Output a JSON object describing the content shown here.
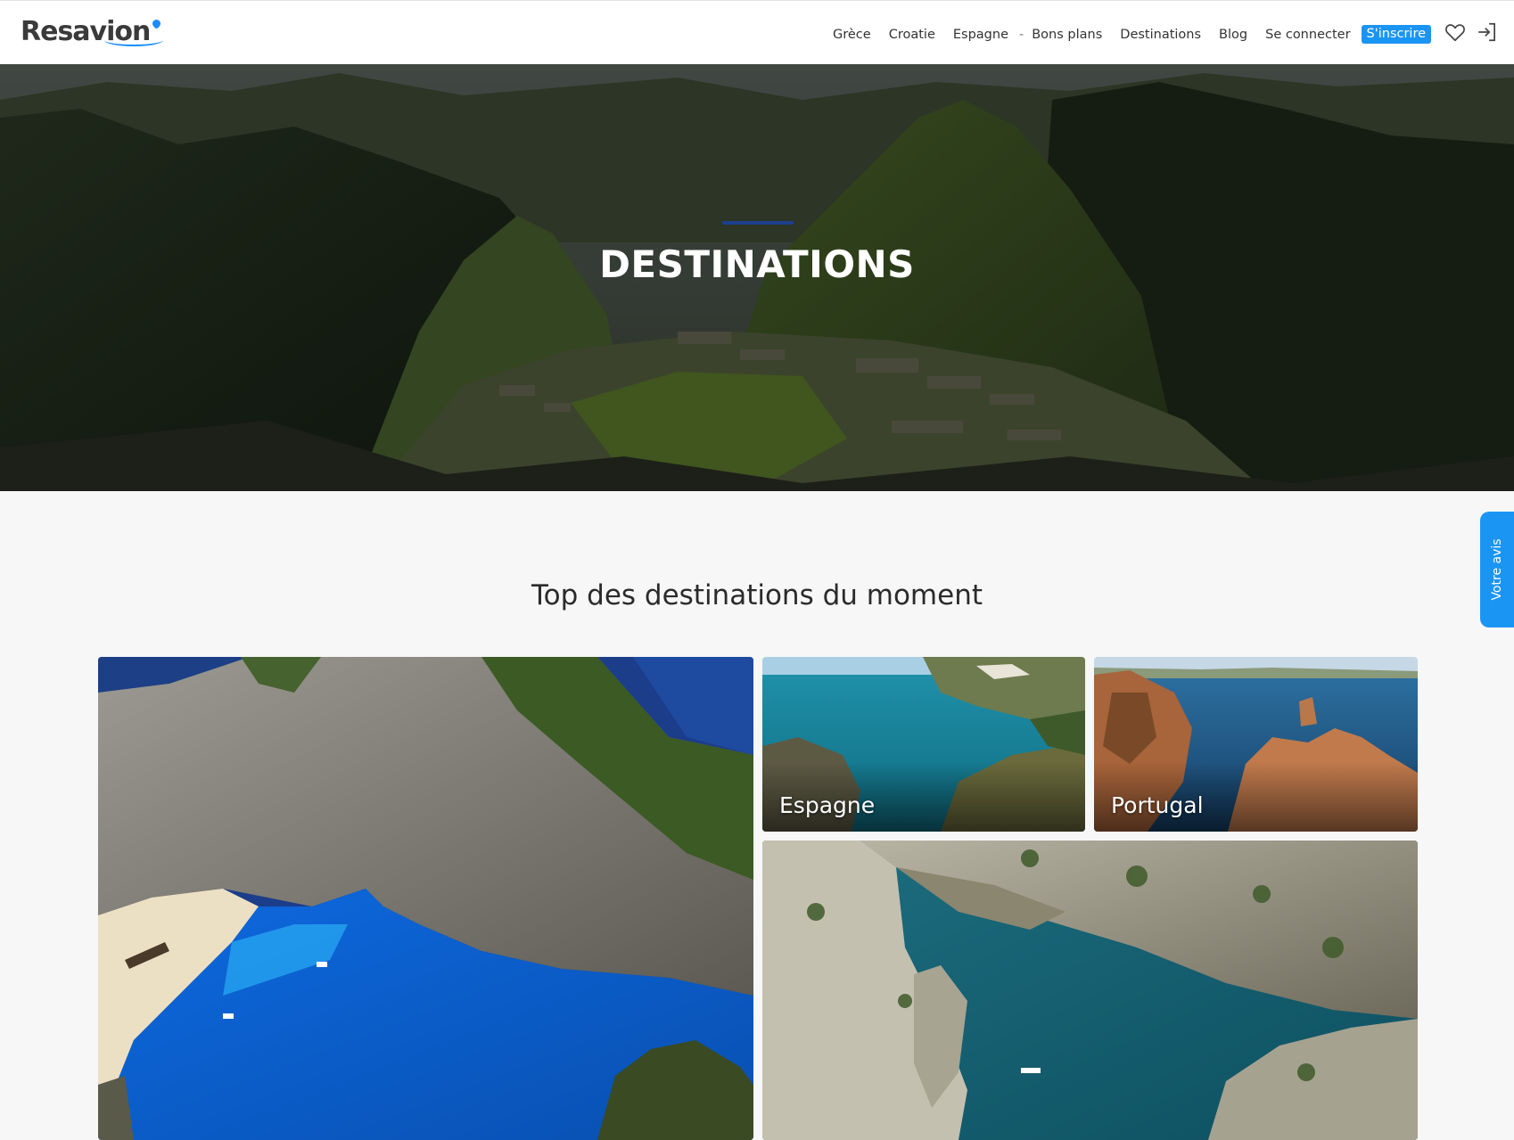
{
  "header": {
    "logo_text": "Resavion",
    "nav": [
      "Grèce",
      "Croatie",
      "Espagne",
      "Bons plans",
      "Destinations",
      "Blog",
      "Se connecter"
    ],
    "nav_separator": "-",
    "signup_label": "S'inscrire",
    "icons": [
      "heart-icon",
      "login-icon"
    ]
  },
  "hero": {
    "title": "DESTINATIONS"
  },
  "feedback_tab": {
    "label": "Votre avis"
  },
  "section": {
    "title": "Top des destinations du moment",
    "cards": [
      {
        "label": ""
      },
      {
        "label": "Espagne"
      },
      {
        "label": "Portugal"
      },
      {
        "label": ""
      }
    ]
  },
  "colors": {
    "accent": "#1b95f3",
    "hero_bar": "#1d3f8c",
    "background": "#f7f7f7"
  }
}
